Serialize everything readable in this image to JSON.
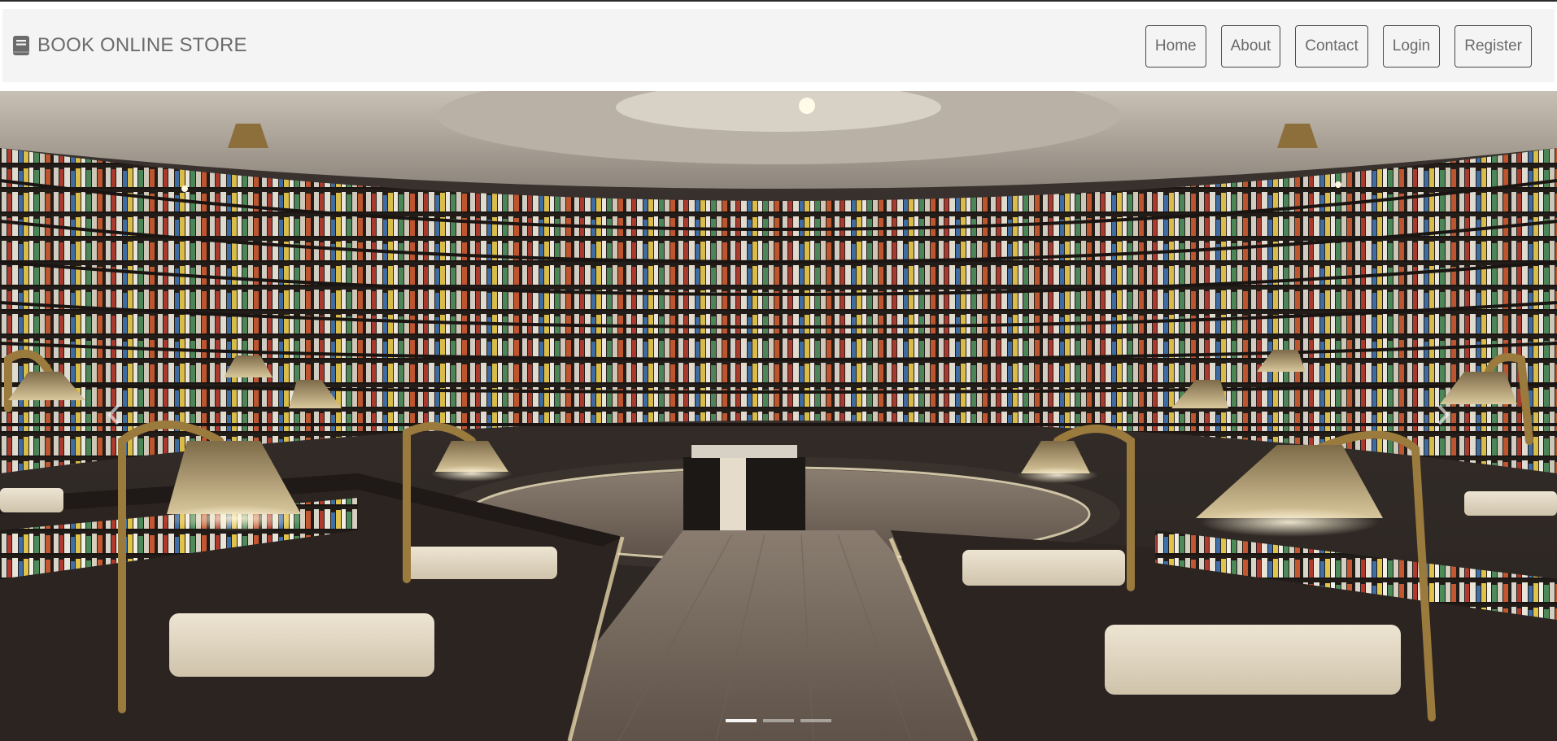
{
  "navbar": {
    "brand_icon": "book-icon",
    "brand_text": "BOOK ONLINE STORE",
    "links": [
      {
        "label": "Home"
      },
      {
        "label": "About"
      },
      {
        "label": "Contact"
      },
      {
        "label": "Login"
      },
      {
        "label": "Register"
      }
    ]
  },
  "carousel": {
    "slide_image": "bookstore-interior-photo",
    "prev_icon": "chevron-left-icon",
    "next_icon": "chevron-right-icon",
    "slide_count": 3,
    "active_slide": 1
  },
  "colors": {
    "navbar_bg": "#f4f4f4",
    "nav_text": "#6b6b6b",
    "nav_border": "#4a4a4a"
  }
}
